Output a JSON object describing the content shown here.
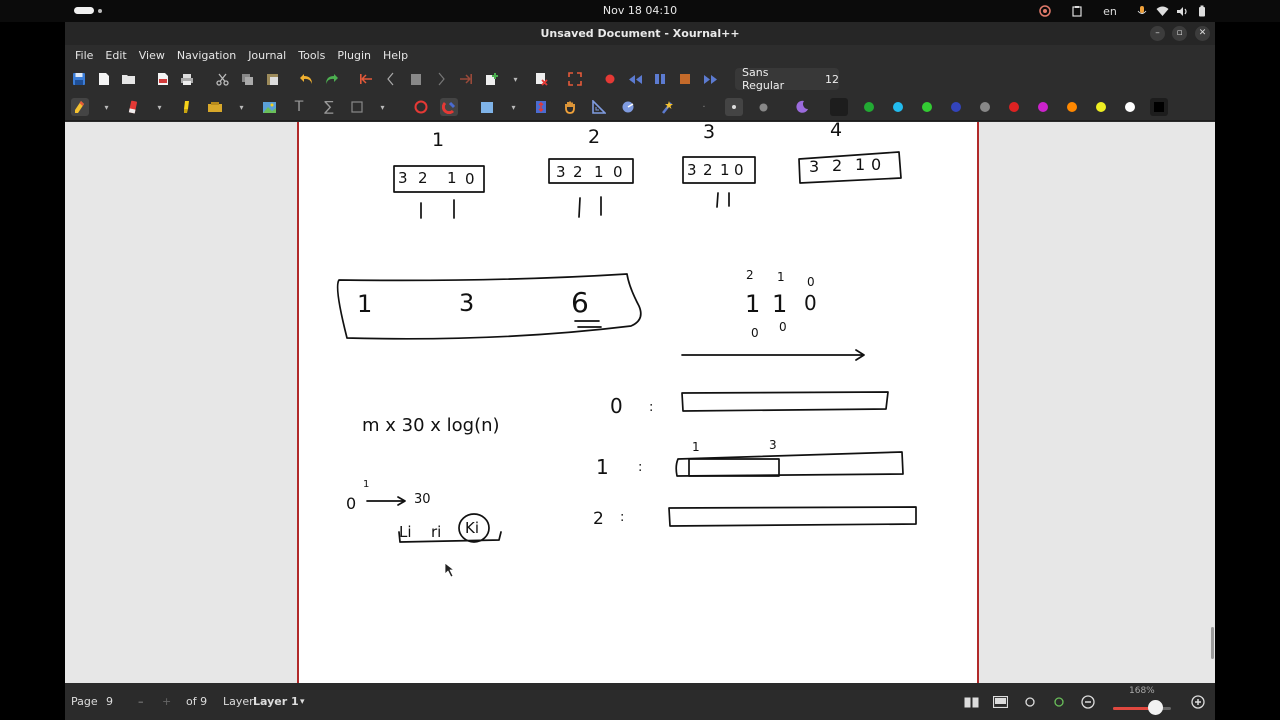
{
  "system": {
    "clock": "Nov 18  04:10",
    "language": "en"
  },
  "window": {
    "title": "Unsaved Document - Xournal++"
  },
  "menu": [
    "File",
    "Edit",
    "View",
    "Navigation",
    "Journal",
    "Tools",
    "Plugin",
    "Help"
  ],
  "toolbar": {
    "font_name": "Sans Regular",
    "font_size": "12"
  },
  "colors": {
    "palette": [
      "#111111",
      "#22aa33",
      "#22bbee",
      "#33cc33",
      "#3344bb",
      "#888888",
      "#dd2222",
      "#cc22cc",
      "#ff8800",
      "#eeee22",
      "#ffffff",
      "#000000"
    ],
    "page_border": "#b12a2a"
  },
  "notes": {
    "row1_numbers": [
      "1",
      "2",
      "3",
      "4"
    ],
    "bit_box": [
      "3",
      "2",
      "1",
      "0"
    ],
    "big_box": [
      "1",
      "3",
      "6"
    ],
    "bit_stack_top": [
      "2",
      "1",
      "0"
    ],
    "bit_stack_mid": [
      "1",
      "1",
      "0"
    ],
    "bit_stack_bottom": [
      "0",
      "0"
    ],
    "formula": "m x 30 x log(n)",
    "range_start": "0",
    "range_tick": "1",
    "range_end": "30",
    "vars": [
      "Li",
      "ri",
      "Ki"
    ],
    "levels": [
      "0",
      "1",
      "2"
    ],
    "level1_marks": [
      "1",
      "3"
    ]
  },
  "status": {
    "page_label": "Page",
    "page_number": "9",
    "page_of": "of 9",
    "layer_label": "Layer",
    "layer_name": "Layer 1",
    "zoom": "168%",
    "zoom_fraction": 0.72
  }
}
